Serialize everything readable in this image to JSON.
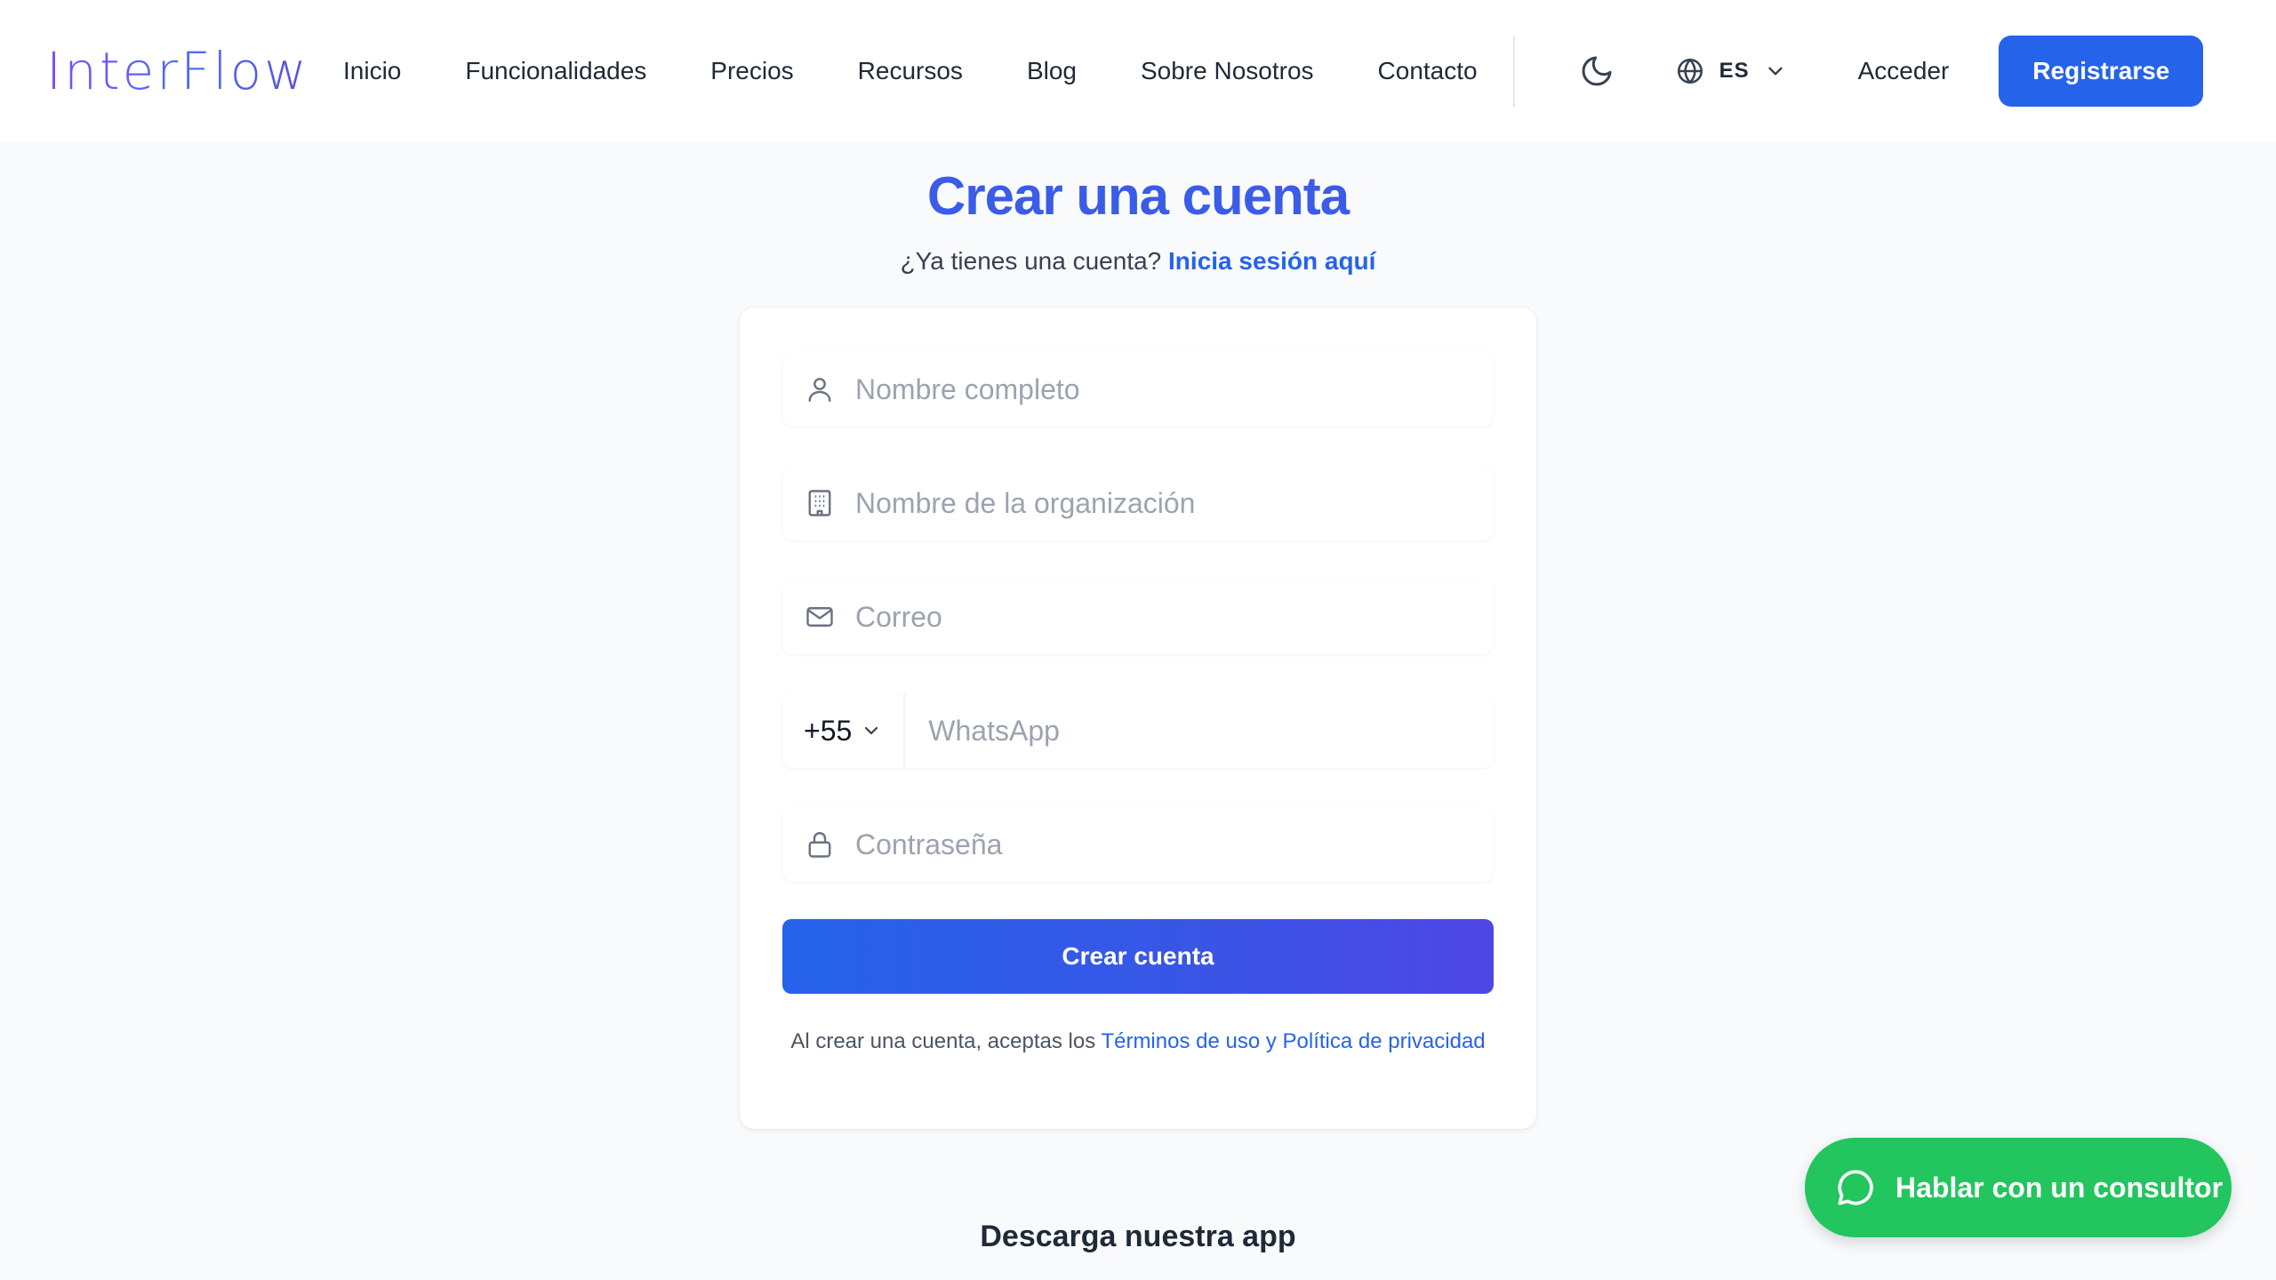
{
  "header": {
    "logo": "InterFlow",
    "nav": [
      "Inicio",
      "Funcionalidades",
      "Precios",
      "Recursos",
      "Blog",
      "Sobre Nosotros",
      "Contacto"
    ],
    "language": "ES",
    "login": "Acceder",
    "signup": "Registrarse"
  },
  "main": {
    "title": "Crear una cuenta",
    "subtitle_prefix": "¿Ya tienes una cuenta?",
    "subtitle_link": "Inicia sesión aquí"
  },
  "form": {
    "name_placeholder": "Nombre completo",
    "org_placeholder": "Nombre de la organización",
    "email_placeholder": "Correo",
    "phone_code": "+55",
    "phone_placeholder": "WhatsApp",
    "password_placeholder": "Contraseña",
    "submit": "Crear cuenta",
    "terms_prefix": "Al crear una cuenta, aceptas los",
    "terms_link": "Términos de uso y Política de privacidad"
  },
  "download_title": "Descarga nuestra app",
  "chat_button": "Hablar con un consultor",
  "icons": {
    "theme": "moon-icon",
    "language": "globe-icon",
    "name": "user-icon",
    "org": "building-icon",
    "email": "mail-icon",
    "password": "lock-icon",
    "chat": "chat-bubble-icon"
  },
  "colors": {
    "primary": "#2563eb",
    "title": "#3b5ce6",
    "chat": "#22c55e"
  }
}
